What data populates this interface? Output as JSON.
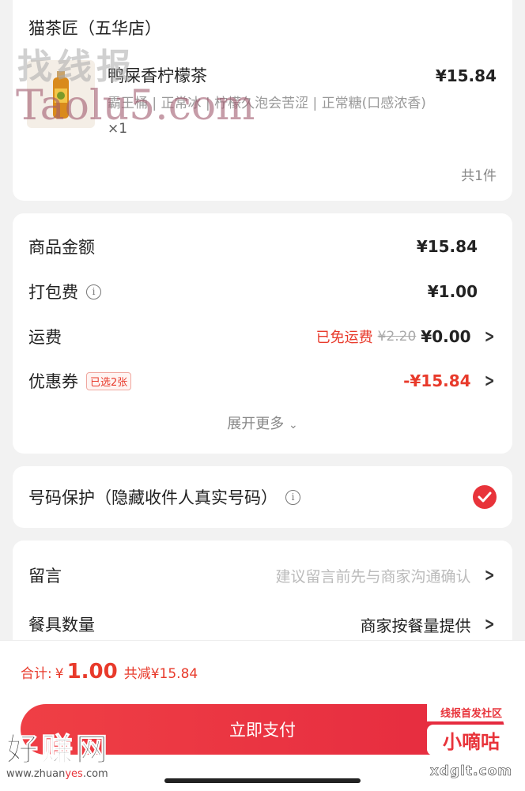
{
  "order": {
    "store_name": "猫茶匠（五华店）",
    "item": {
      "name": "鸭屎香柠檬茶",
      "price": "¥15.84",
      "specs": "霸王桶 | 正常冰 | 柠檬久泡会苦涩 | 正常糖(口感浓香)",
      "qty": "×1",
      "image_icon": "lemon-tea-bottle-icon"
    },
    "total_count": "共1件"
  },
  "fees": {
    "goods_amount_label": "商品金额",
    "goods_amount": "¥15.84",
    "packing_label": "打包费",
    "packing_fee": "¥1.00",
    "shipping_label": "运费",
    "shipping_free_tag": "已免运费",
    "shipping_original": "¥2.20",
    "shipping_fee": "¥0.00",
    "coupon_label": "优惠券",
    "coupon_badge": "已选2张",
    "coupon_amount": "-¥15.84",
    "expand_label": "展开更多"
  },
  "privacy": {
    "label": "号码保护（隐藏收件人真实号码）",
    "checked": true
  },
  "extras": {
    "message_label": "留言",
    "message_placeholder": "建议留言前先与商家沟通确认",
    "tableware_label": "餐具数量",
    "tableware_value": "商家按餐量提供"
  },
  "footer": {
    "total_label": "合计:",
    "currency": "¥",
    "total_amount": "1.00",
    "discount_text": "共减¥15.84",
    "pay_button": "立即支付"
  },
  "watermarks": {
    "top_cn": "找线报",
    "top_en": "Taolu5.com",
    "bottom_left_cn": "好赚网",
    "bottom_left_url_a": "www.zhuan",
    "bottom_left_url_b": "yes",
    "bottom_left_url_c": ".com",
    "bottom_right_top": "线报首发社区",
    "bottom_right_main": "小嘀咕",
    "bottom_right_url": "xdglt.com"
  },
  "colors": {
    "accent_red": "#e8333a",
    "price_red": "#e83a2b",
    "background": "#f2f2f2"
  }
}
